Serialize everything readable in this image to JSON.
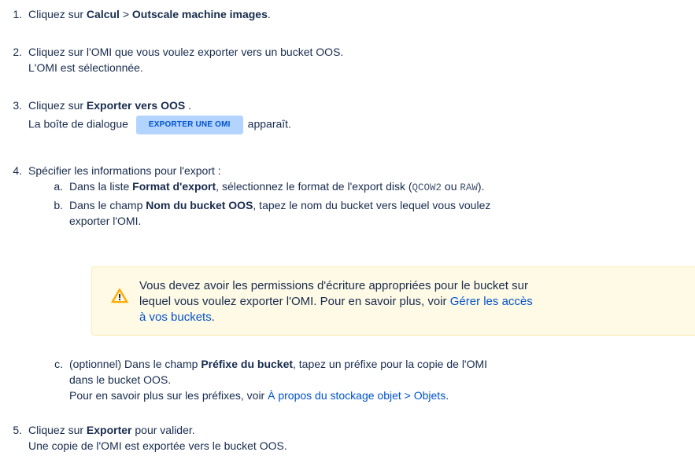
{
  "steps": {
    "s1": {
      "num": "1.",
      "pre": "Cliquez sur ",
      "b1": "Calcul",
      "mid": " > ",
      "b2": "Outscale machine images",
      "post": "."
    },
    "s2": {
      "num": "2.",
      "line1": "Cliquez sur l'OMI que vous voulez exporter vers un bucket OOS.",
      "line2": "L'OMI est sélectionnée."
    },
    "s3": {
      "num": "3.",
      "pre": "Cliquez sur ",
      "b1": "Exporter vers OOS",
      "post": " .",
      "line2_pre": "La boîte de dialogue",
      "chip": "EXPORTER UNE OMI",
      "line2_post": "apparaît."
    },
    "s4": {
      "num": "4.",
      "text": "Spécifier les informations pour l'export :",
      "a": {
        "letter": "a.",
        "pre": "Dans la liste ",
        "bold": "Format d'export",
        "mid": ", sélectionnez le format de l'export disk (",
        "code1": "QCOW2",
        "or": " ou ",
        "code2": "RAW",
        "post": ")."
      },
      "b": {
        "letter": "b.",
        "pre": "Dans le champ ",
        "bold": "Nom du bucket OOS",
        "post": ", tapez le nom du bucket vers lequel vous voulez",
        "line2": "exporter l'OMI."
      },
      "warning": {
        "line1": "Vous devez avoir les permissions d'écriture appropriées pour le bucket sur",
        "line2_pre": "lequel vous voulez exporter l'OMI. Pour en savoir plus, voir ",
        "link_part1": "Gérer les accès",
        "link_part2": "à vos buckets",
        "post": "."
      },
      "c": {
        "letter": "c.",
        "pre": "(optionnel) Dans le champ ",
        "bold": "Préfixe du bucket",
        "post": ", tapez un préfixe pour la copie de l'OMI",
        "line2": "dans le bucket OOS.",
        "line3_pre": "Pour en savoir plus sur les préfixes, voir ",
        "link": "À propos du stockage objet > Objets",
        "line3_post": "."
      }
    },
    "s5": {
      "num": "5.",
      "pre": "Cliquez sur ",
      "b1": "Exporter",
      "post": " pour valider.",
      "line2": "Une copie de l'OMI est exportée vers le bucket OOS."
    }
  },
  "colors": {
    "link": "#0052cc",
    "chip_bg": "#b3d4ff",
    "warning_bg": "#fffae6",
    "warning_icon": "#ffab00"
  }
}
